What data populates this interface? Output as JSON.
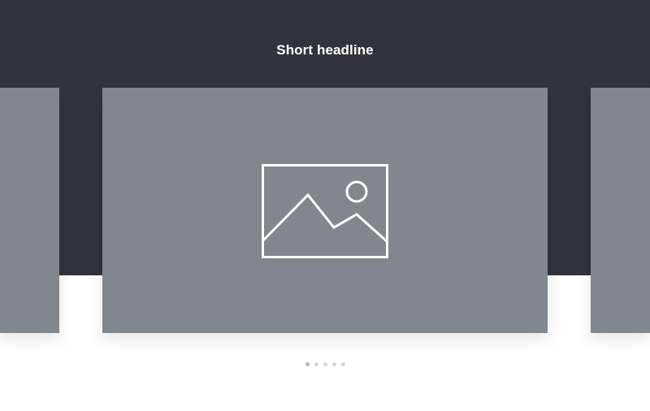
{
  "header": {
    "headline": "Short headline"
  },
  "carousel": {
    "slides": [
      {
        "role": "previous"
      },
      {
        "role": "current",
        "icon": "image-placeholder-icon"
      },
      {
        "role": "next"
      }
    ],
    "pagination": {
      "total": 5,
      "active": 1
    }
  },
  "colors": {
    "hero_background": "#30353d",
    "slide_background": "#81878e",
    "headline_text": "#ffffff",
    "dot_active": "#b7bcc2",
    "dot_inactive": "#d3d6da"
  }
}
